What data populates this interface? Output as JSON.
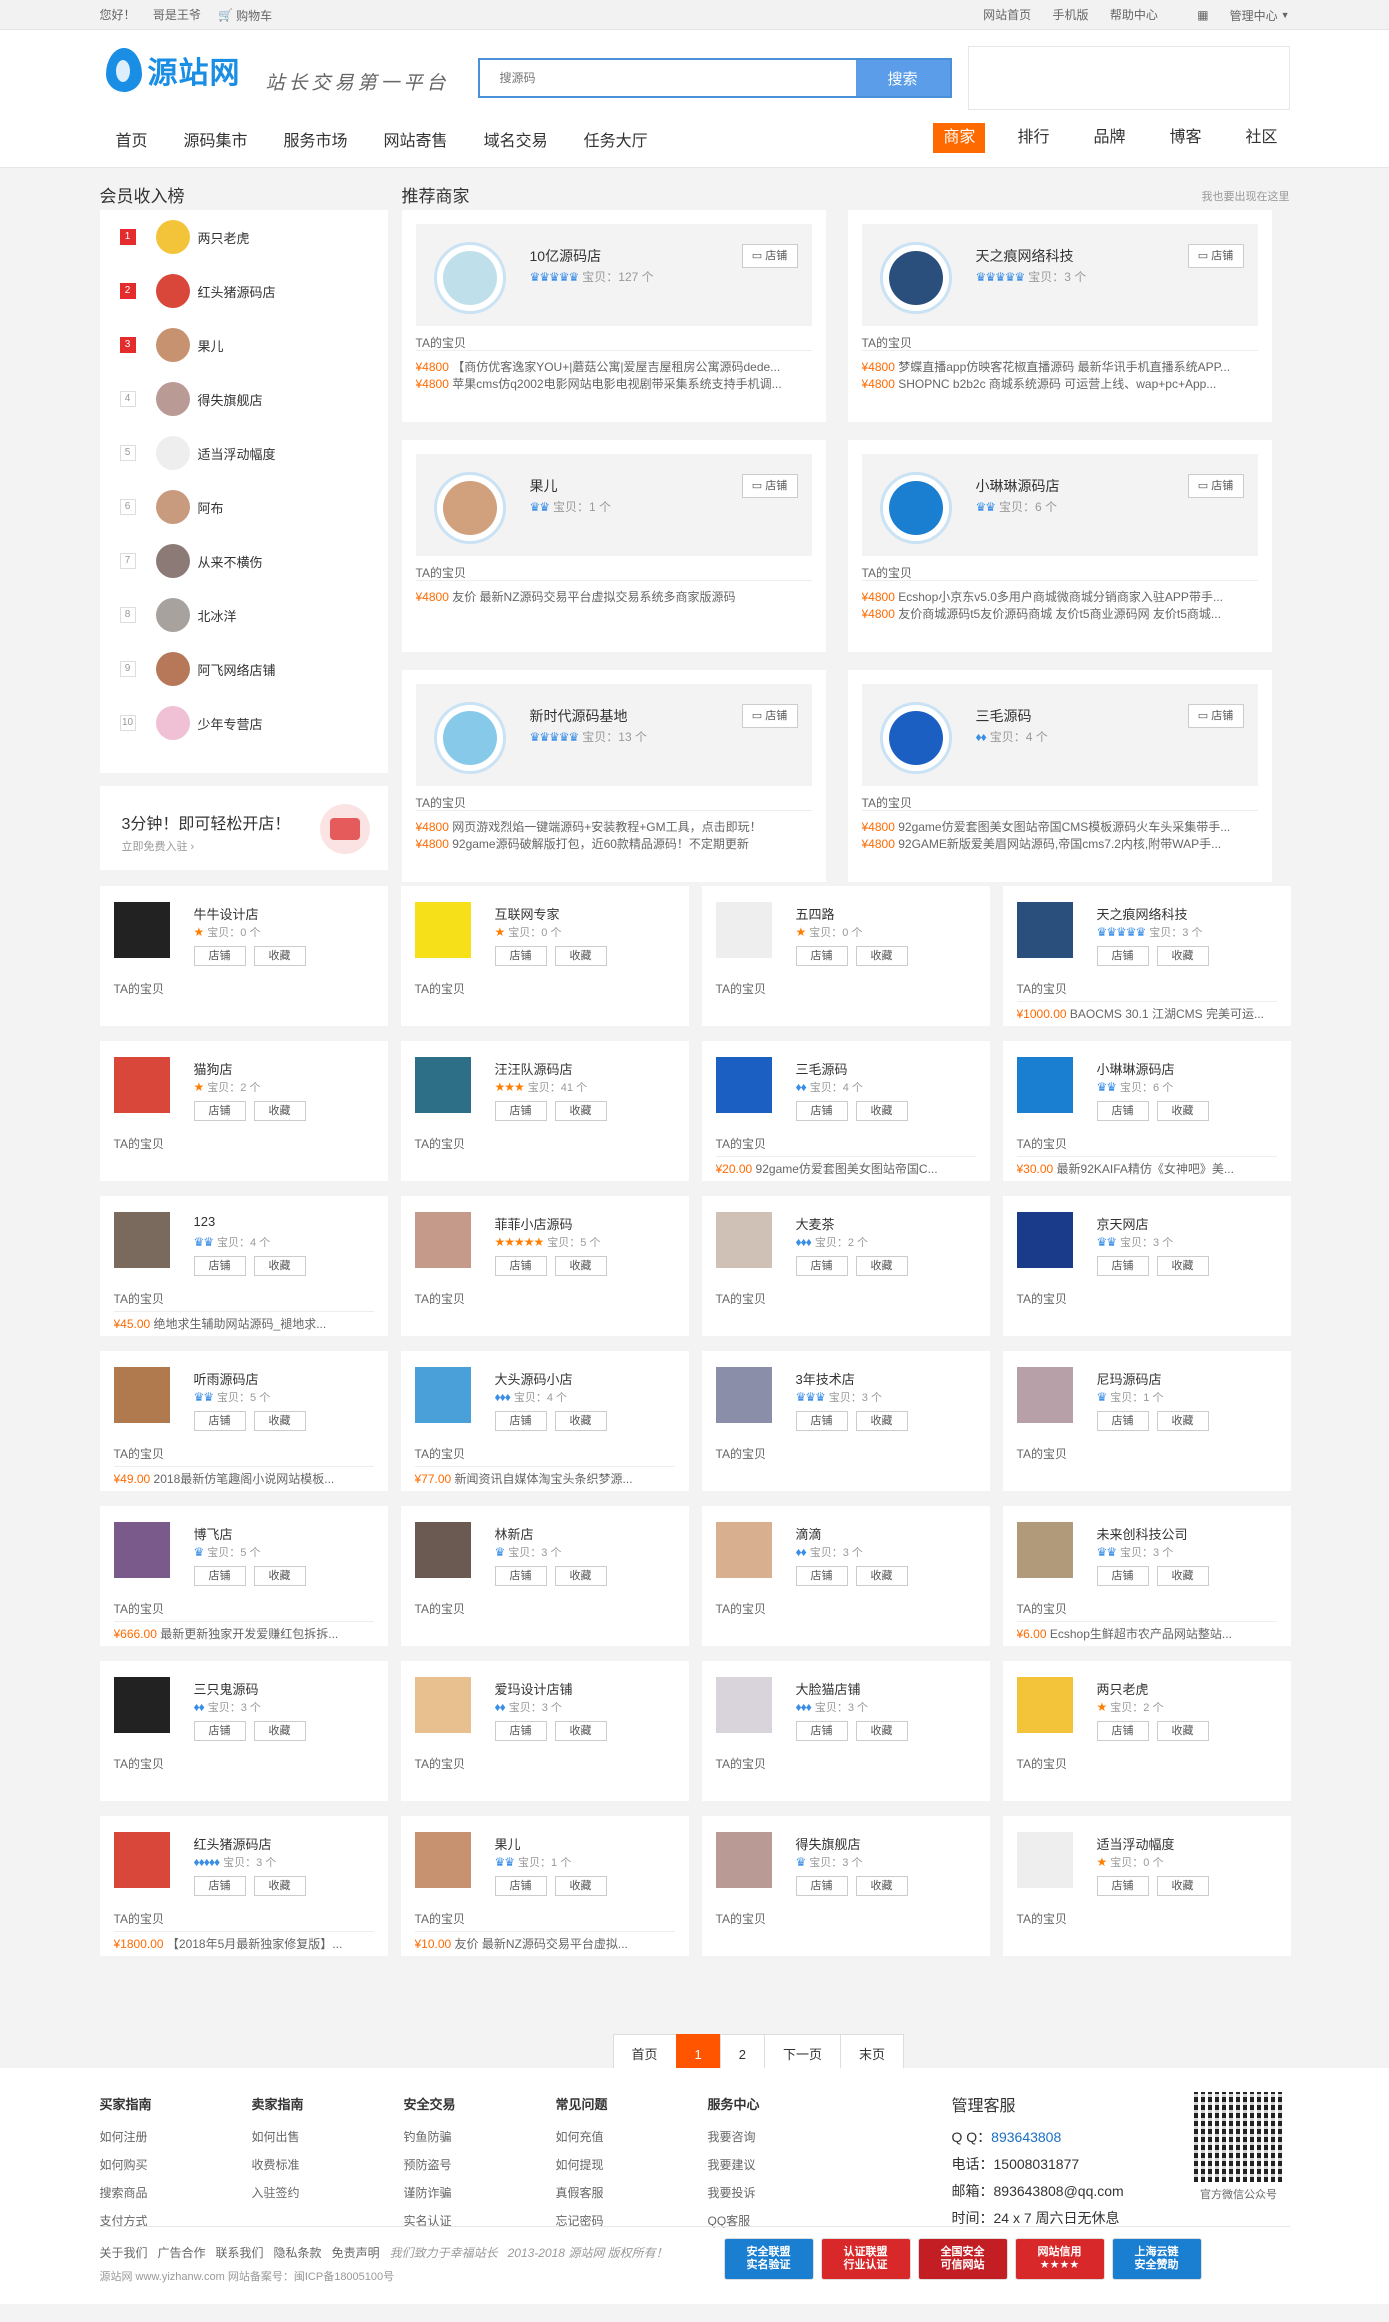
{
  "topbar": {
    "greeting": "您好！",
    "user": "哥是王爷",
    "cart": "购物车",
    "links": [
      "网站首页",
      "手机版",
      "帮助中心",
      "管理中心"
    ]
  },
  "logo": {
    "text": "源站网",
    "slogan": "站长交易第一平台"
  },
  "search": {
    "placeholder": "搜源码",
    "button": "搜索"
  },
  "nav": [
    "首页",
    "源码集市",
    "服务市场",
    "网站寄售",
    "域名交易",
    "任务大厅"
  ],
  "nav2": [
    {
      "label": "商家",
      "active": true
    },
    {
      "label": "排行"
    },
    {
      "label": "品牌"
    },
    {
      "label": "博客"
    },
    {
      "label": "社区"
    }
  ],
  "rank": {
    "title": "会员收入榜",
    "items": [
      {
        "n": "1",
        "name": "两只老虎",
        "c": "#f3c43a"
      },
      {
        "n": "2",
        "name": "红头猪源码店",
        "c": "#d9463a"
      },
      {
        "n": "3",
        "name": "果儿",
        "c": "#c79270"
      },
      {
        "n": "4",
        "name": "得失旗舰店",
        "c": "#b99a94"
      },
      {
        "n": "5",
        "name": "适当浮动幅度",
        "c": "#eeeeee"
      },
      {
        "n": "6",
        "name": "阿布",
        "c": "#c99b7e"
      },
      {
        "n": "7",
        "name": "从来不横伤",
        "c": "#8c7a77"
      },
      {
        "n": "8",
        "name": "北冰洋",
        "c": "#a7a29e"
      },
      {
        "n": "9",
        "name": "阿飞网络店铺",
        "c": "#b7785a"
      },
      {
        "n": "10",
        "name": "少年专营店",
        "c": "#f0c0d4"
      }
    ]
  },
  "openshop": {
    "title": "3分钟！即可轻松开店！",
    "sub": "立即免费入驻 ›"
  },
  "rec": {
    "title": "推荐商家",
    "right": "我也要出现在这里",
    "ta": "TA的宝贝",
    "shop": "店铺",
    "items": [
      {
        "name": "10亿源码店",
        "stars": "♛♛♛♛♛",
        "cnt": "宝贝：127 个",
        "c": "#bfe0ea",
        "lines": [
          [
            "¥4800",
            "【商仿优客逸家YOU+|蘑菇公寓|爱屋吉屋租房公寓源码dede..."
          ],
          [
            "¥4800",
            "苹果cms仿q2002电影网站电影电视剧带采集系统支持手机调..."
          ]
        ]
      },
      {
        "name": "天之痕网络科技",
        "stars": "♛♛♛♛♛",
        "cnt": "宝贝：3 个",
        "c": "#2a4f7c",
        "lines": [
          [
            "¥4800",
            "梦蝶直播app仿映客花椒直播源码 最新华讯手机直播系统APP..."
          ],
          [
            "¥4800",
            "SHOPNC b2b2c 商城系统源码 可运营上线、wap+pc+App..."
          ]
        ]
      },
      {
        "name": "果儿",
        "stars": "♛♛",
        "cnt": "宝贝：1 个",
        "c": "#d1a07c",
        "lines": [
          [
            "¥4800",
            "友价 最新NZ源码交易平台虚拟交易系统多商家版源码"
          ]
        ]
      },
      {
        "name": "小琳琳源码店",
        "stars": "♛♛",
        "cnt": "宝贝：6 个",
        "c": "#1a7ed1",
        "lines": [
          [
            "¥4800",
            "Ecshop小京东v5.0多用户商城微商城分销商家入驻APP带手..."
          ],
          [
            "¥4800",
            "友价商城源码t5友价源码商城 友价t5商业源码网 友价t5商城..."
          ]
        ]
      },
      {
        "name": "新时代源码基地",
        "stars": "♛♛♛♛♛",
        "cnt": "宝贝：13 个",
        "c": "#87c9e8",
        "lines": [
          [
            "¥4800",
            "网页游戏烈焰一键端源码+安装教程+GM工具，点击即玩！"
          ],
          [
            "¥4800",
            "92game源码破解版打包，近60款精品源码！不定期更新"
          ]
        ]
      },
      {
        "name": "三毛源码",
        "stars": "♦♦",
        "cnt": "宝贝：4 个",
        "c": "#1b5fc2",
        "lines": [
          [
            "¥4800",
            "92game仿爱套图美女图站帝国CMS模板源码火车头采集带手..."
          ],
          [
            "¥4800",
            "92GAME新版爱美眉网站源码,帝国cms7.2内核,附带WAP手..."
          ]
        ]
      }
    ]
  },
  "cards": {
    "ta": "TA的宝贝",
    "b1": "店铺",
    "b2": "收藏",
    "items": [
      {
        "name": "牛牛设计店",
        "st": "★",
        "sc": "or",
        "cnt": "宝贝：0 个",
        "c": "#222222",
        "line": null
      },
      {
        "name": "互联网专家",
        "st": "★",
        "sc": "or",
        "cnt": "宝贝：0 个",
        "c": "#f5e01a",
        "line": null
      },
      {
        "name": "五四路",
        "st": "★",
        "sc": "or",
        "cnt": "宝贝：0 个",
        "c": "#eeeeee",
        "line": null
      },
      {
        "name": "天之痕网络科技",
        "st": "♛♛♛♛♛",
        "sc": "bd",
        "cnt": "宝贝：3 个",
        "c": "#2a4f7c",
        "line": [
          "¥1000.00",
          "BAOCMS 30.1 江湖CMS 完美可运..."
        ]
      },
      {
        "name": "猫狗店",
        "st": "★",
        "sc": "or",
        "cnt": "宝贝：2 个",
        "c": "#d9463a",
        "line": null
      },
      {
        "name": "汪汪队源码店",
        "st": "★★★",
        "sc": "or",
        "cnt": "宝贝：41 个",
        "c": "#2e6f88",
        "line": null
      },
      {
        "name": "三毛源码",
        "st": "♦♦",
        "sc": "bd",
        "cnt": "宝贝：4 个",
        "c": "#1b5fc2",
        "line": [
          "¥20.00",
          "92game仿爱套图美女图站帝国C..."
        ]
      },
      {
        "name": "小琳琳源码店",
        "st": "♛♛",
        "sc": "bd",
        "cnt": "宝贝：6 个",
        "c": "#1a7ed1",
        "line": [
          "¥30.00",
          "最新92KAIFA精仿《女神吧》美..."
        ]
      },
      {
        "name": "123",
        "st": "♛♛",
        "sc": "bd",
        "cnt": "宝贝：4 个",
        "c": "#7a6a5e",
        "line": [
          "¥45.00",
          "绝地求生辅助网站源码_褪地求..."
        ]
      },
      {
        "name": "菲菲小店源码",
        "st": "★★★★★",
        "sc": "or",
        "cnt": "宝贝：5 个",
        "c": "#c59a8a",
        "line": null
      },
      {
        "name": "大麦茶",
        "st": "♦♦♦",
        "sc": "bd",
        "cnt": "宝贝：2 个",
        "c": "#cfc1b5",
        "line": null
      },
      {
        "name": "京天网店",
        "st": "♛♛",
        "sc": "bd",
        "cnt": "宝贝：3 个",
        "c": "#1a3a8a",
        "line": null
      },
      {
        "name": "听雨源码店",
        "st": "♛♛",
        "sc": "bd",
        "cnt": "宝贝：5 个",
        "c": "#b07a4e",
        "line": [
          "¥49.00",
          "2018最新仿笔趣阁小说网站模板..."
        ]
      },
      {
        "name": "大头源码小店",
        "st": "♦♦♦",
        "sc": "bd",
        "cnt": "宝贝：4 个",
        "c": "#4aa0d8",
        "line": [
          "¥77.00",
          "新闻资讯自媒体淘宝头条织梦源..."
        ]
      },
      {
        "name": "3年技术店",
        "st": "♛♛♛",
        "sc": "bd",
        "cnt": "宝贝：3 个",
        "c": "#8a8ea8",
        "line": null
      },
      {
        "name": "尼玛源码店",
        "st": "♛",
        "sc": "bd",
        "cnt": "宝贝：1 个",
        "c": "#b8a0a8",
        "line": null
      },
      {
        "name": "博飞店",
        "st": "♛",
        "sc": "bd",
        "cnt": "宝贝：5 个",
        "c": "#7a5a8a",
        "line": [
          "¥666.00",
          "最新更新独家开发爱赚红包拆拆..."
        ]
      },
      {
        "name": "林新店",
        "st": "♛",
        "sc": "bd",
        "cnt": "宝贝：3 个",
        "c": "#6a5a52",
        "line": null
      },
      {
        "name": "滴滴",
        "st": "♦♦",
        "sc": "bd",
        "cnt": "宝贝：3 个",
        "c": "#d8b090",
        "line": null
      },
      {
        "name": "未来创科技公司",
        "st": "♛♛",
        "sc": "bd",
        "cnt": "宝贝：3 个",
        "c": "#b09a7a",
        "line": [
          "¥6.00",
          "Ecshop生鲜超市农产品网站整站..."
        ]
      },
      {
        "name": "三只鬼源码",
        "st": "♦♦",
        "sc": "bd",
        "cnt": "宝贝：3 个",
        "c": "#222222",
        "line": null
      },
      {
        "name": "爱玛设计店铺",
        "st": "♦♦",
        "sc": "bd",
        "cnt": "宝贝：3 个",
        "c": "#e8c090",
        "line": null
      },
      {
        "name": "大脸猫店铺",
        "st": "♦♦♦",
        "sc": "bd",
        "cnt": "宝贝：3 个",
        "c": "#d9d4dc",
        "line": null
      },
      {
        "name": "两只老虎",
        "st": "★",
        "sc": "or",
        "cnt": "宝贝：2 个",
        "c": "#f3c43a",
        "line": null
      },
      {
        "name": "红头猪源码店",
        "st": "♦♦♦♦♦",
        "sc": "bd",
        "cnt": "宝贝：3 个",
        "c": "#d9463a",
        "line": [
          "¥1800.00",
          "【2018年5月最新独家修复版】..."
        ]
      },
      {
        "name": "果儿",
        "st": "♛♛",
        "sc": "bd",
        "cnt": "宝贝：1 个",
        "c": "#c79270",
        "line": [
          "¥10.00",
          "友价 最新NZ源码交易平台虚拟..."
        ]
      },
      {
        "name": "得失旗舰店",
        "st": "♛",
        "sc": "bd",
        "cnt": "宝贝：3 个",
        "c": "#b99a94",
        "line": null
      },
      {
        "name": "适当浮动幅度",
        "st": "★",
        "sc": "or",
        "cnt": "宝贝：0 个",
        "c": "#eeeeee",
        "line": null
      }
    ]
  },
  "pager": [
    {
      "l": "首页"
    },
    {
      "l": "1",
      "cur": true
    },
    {
      "l": "2"
    },
    {
      "l": "下一页"
    },
    {
      "l": "末页"
    }
  ],
  "footer": {
    "cols": [
      {
        "h": "买家指南",
        "items": [
          "如何注册",
          "如何购买",
          "搜索商品",
          "支付方式"
        ]
      },
      {
        "h": "卖家指南",
        "items": [
          "如何出售",
          "收费标准",
          "入驻签约"
        ]
      },
      {
        "h": "安全交易",
        "items": [
          "钓鱼防骗",
          "预防盗号",
          "谨防诈骗",
          "实名认证"
        ]
      },
      {
        "h": "常见问题",
        "items": [
          "如何充值",
          "如何提现",
          "真假客服",
          "忘记密码"
        ]
      },
      {
        "h": "服务中心",
        "items": [
          "我要咨询",
          "我要建议",
          "我要投诉",
          "QQ客服"
        ]
      }
    ],
    "kf": {
      "h": "管理客服",
      "qq_label": "Q Q：",
      "qq": "893643808",
      "tel": "电话：15008031877",
      "mail": "邮箱：893643808@qq.com",
      "time": "时间：24 x 7 周六日无休息"
    },
    "qr_text": "官方微信公众号",
    "links": [
      "关于我们",
      "广告合作",
      "联系我们",
      "隐私条款",
      "免责声明"
    ],
    "motto": "我们致力于幸福站长",
    "copy": "2013-2018 源站网 版权所有！",
    "icp": "源站网 www.yizhanw.com 网站备案号：闽ICP备18005100号",
    "badges": [
      {
        "t": "安全联盟\n实名验证",
        "c": "#1a7ed1"
      },
      {
        "t": "认证联盟\n行业认证",
        "c": "#d8282a"
      },
      {
        "t": "全国安全\n可信网站",
        "c": "#c21e24"
      },
      {
        "t": "网站信用\n★★★★",
        "c": "#d8282a"
      },
      {
        "t": "上海云链\n安全赞助",
        "c": "#1a7ed1"
      }
    ]
  }
}
